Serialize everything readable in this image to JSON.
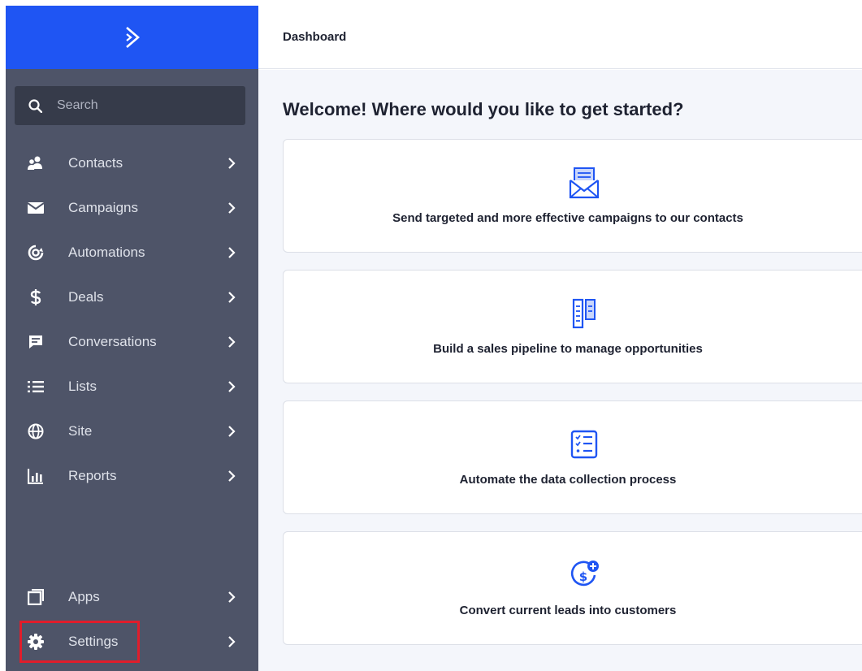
{
  "brand": {
    "logo_icon": "chevron-logo-icon",
    "logo_color": "#1f55f3"
  },
  "topbar": {
    "title": "Dashboard"
  },
  "sidebar": {
    "search": {
      "label": "Search",
      "icon": "search-icon"
    },
    "items": [
      {
        "label": "Contacts",
        "icon": "contacts-icon"
      },
      {
        "label": "Campaigns",
        "icon": "envelope-icon"
      },
      {
        "label": "Automations",
        "icon": "automations-icon"
      },
      {
        "label": "Deals",
        "icon": "dollar-icon"
      },
      {
        "label": "Conversations",
        "icon": "chat-icon"
      },
      {
        "label": "Lists",
        "icon": "list-icon"
      },
      {
        "label": "Site",
        "icon": "globe-icon"
      },
      {
        "label": "Reports",
        "icon": "bar-chart-icon"
      }
    ],
    "bottom_items": [
      {
        "label": "Apps",
        "icon": "apps-icon"
      },
      {
        "label": "Settings",
        "icon": "gear-icon",
        "highlighted": true
      }
    ]
  },
  "main": {
    "welcome": "Welcome! Where would you like to get started?",
    "cards": [
      {
        "text": "Send targeted and more effective campaigns to our contacts",
        "icon": "campaign-envelope-icon"
      },
      {
        "text": "Build a sales pipeline to manage opportunities",
        "icon": "pipeline-icon"
      },
      {
        "text": "Automate the data collection process",
        "icon": "checklist-icon"
      },
      {
        "text": "Convert current leads into customers",
        "icon": "dollar-plus-icon"
      }
    ]
  },
  "colors": {
    "sidebar_bg": "#4e5468",
    "accent": "#1f55f3",
    "highlight_border": "#e11d2b"
  }
}
